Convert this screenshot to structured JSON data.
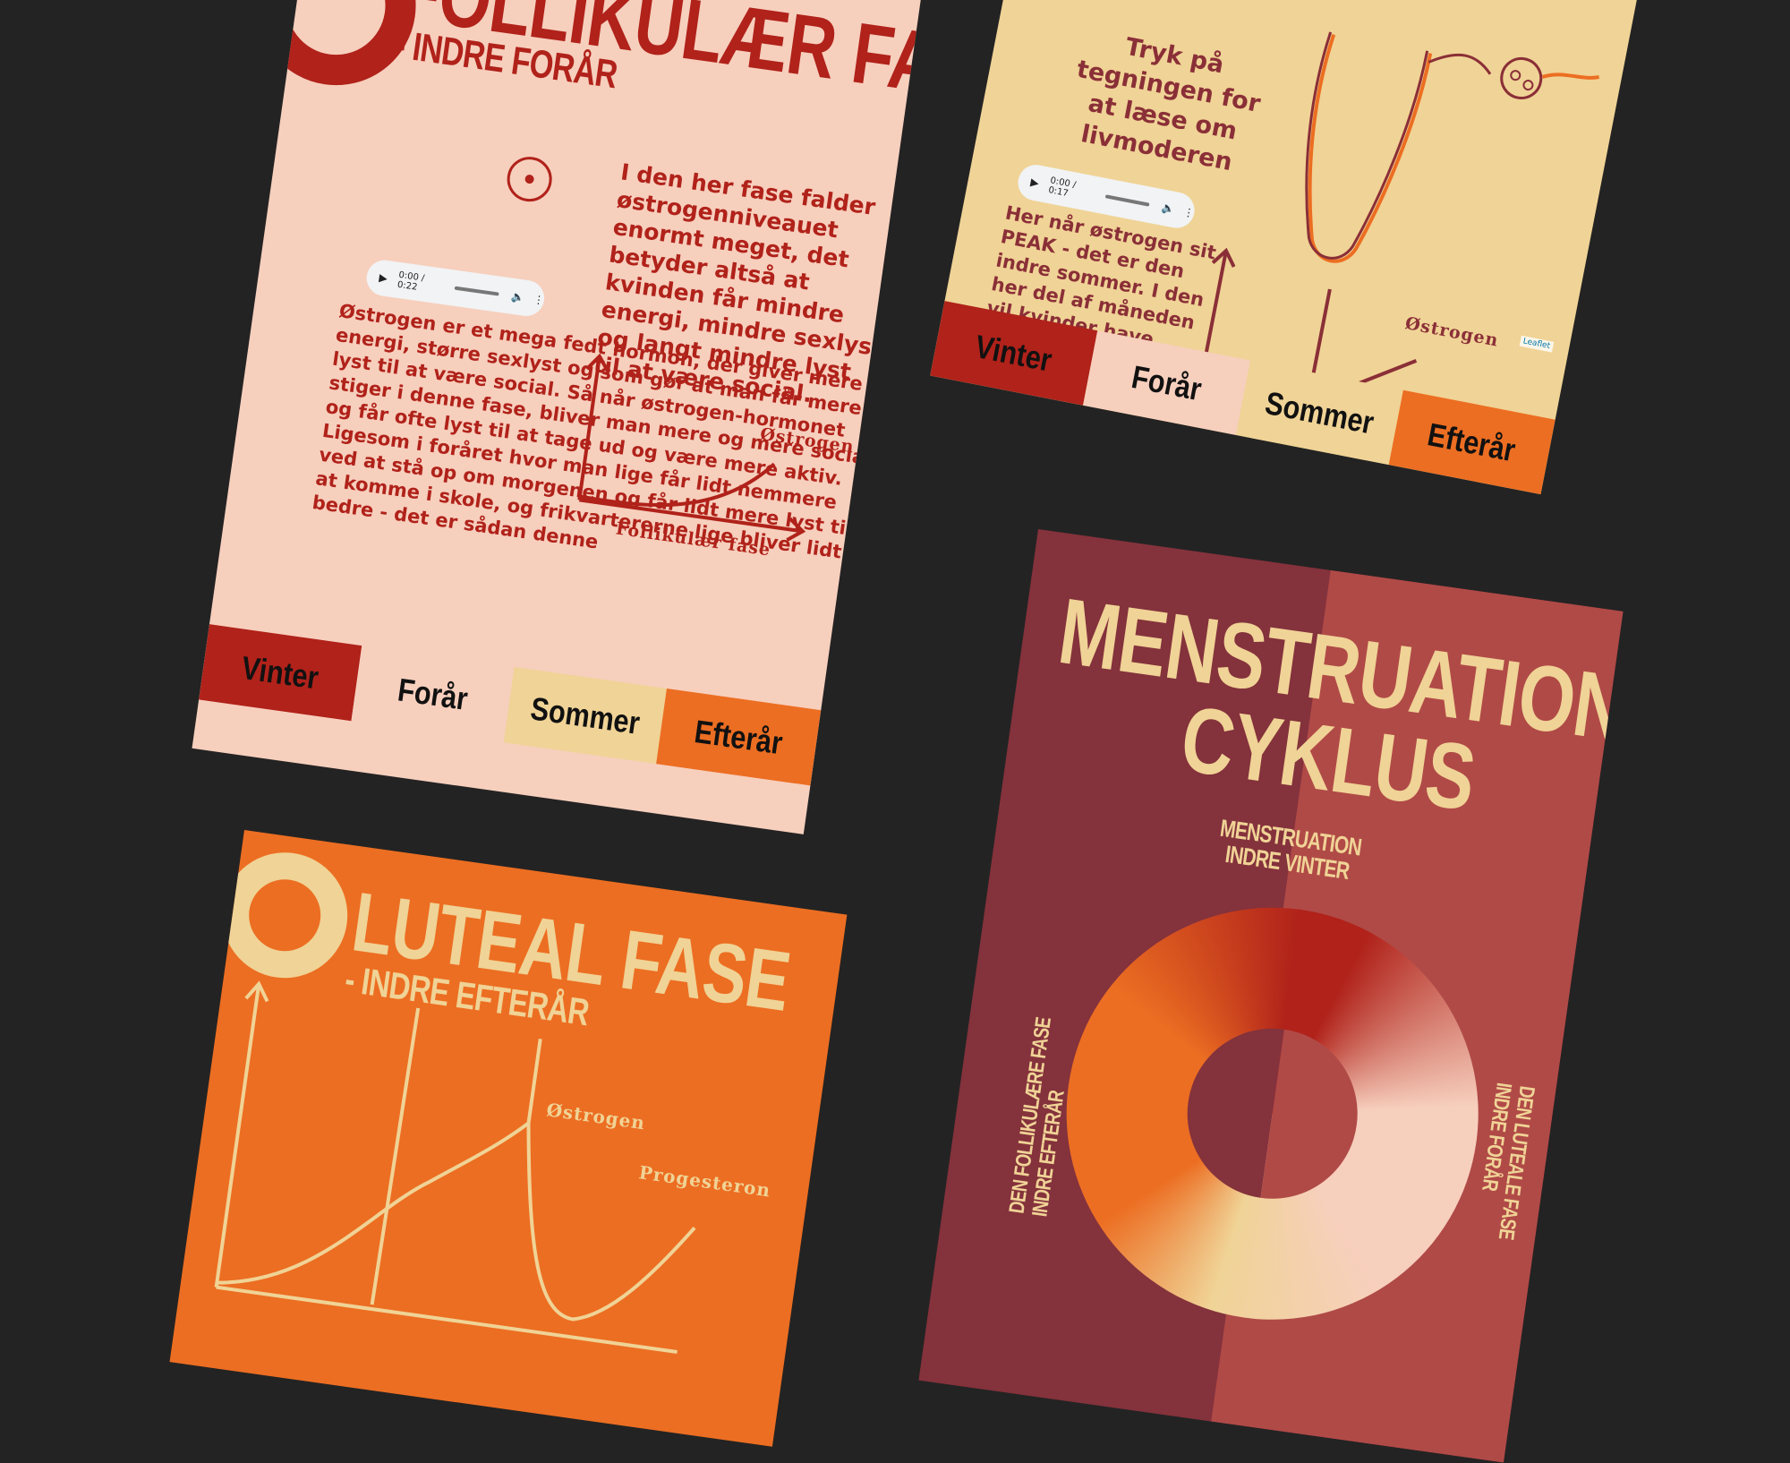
{
  "colors": {
    "background": "#232323",
    "follicular_bg": "#f7cfbd",
    "follicular_accent": "#b0221a",
    "uterus_bg": "#f0d396",
    "uterus_accent": "#8a2f37",
    "luteal_bg": "#ec6e22",
    "luteal_accent": "#f0d396",
    "cycle_bg_left": "#84323c",
    "cycle_bg_right": "#b04a47",
    "tab_vinter": "#b0221a",
    "tab_foraar": "#f7cfbd",
    "tab_sommer": "#f0d396",
    "tab_efteraar": "#ec6e22"
  },
  "follicular": {
    "title": "FOLLIKULÆR FASE",
    "subtitle": "- INDRE FORÅR",
    "intro_text": "I den her fase falder østrogenniveauet enormt meget, det betyder altså at kvinden får mindre energi, mindre sexlyst og langt mindre lyst til at være social.",
    "audio_time": "0:00 / 0:22",
    "body_text": "Østrogen er et mega fedt hormon, der giver mere energi, større sexlyst og som gør at man får mere lyst til at være social. Så når østrogen-hormonet stiger i denne fase, bliver man mere og mere social og får ofte lyst til at tage ud og være mere aktiv. Ligesom i foråret hvor man lige får lidt nemmere ved at stå op om morgenen og får lidt mere lyst til at komme i skole, og frikvartererne lige bliver lidt bedre - det er sådan denne",
    "graph_curve_label": "Østrogen",
    "graph_axis_label": "Follikulær fase",
    "target_icon": "target-icon",
    "tabs": [
      "Vinter",
      "Forår",
      "Sommer",
      "Efterår"
    ]
  },
  "uterus": {
    "prompt": "Tryk på tegningen for at læse om livmoderen",
    "audio_time": "0:00 / 0:17",
    "peak_text_before": "Her når østrogen sit",
    "peak_word": "PEAK",
    "peak_text_after": "- det er den indre sommer. I den her del af måneden vil kvinder have allermest energi,",
    "graph_curve_label": "Østrogen",
    "map_attribution": "Leaflet",
    "tabs": [
      "Vinter",
      "Forår",
      "Sommer",
      "Efterår"
    ]
  },
  "luteal": {
    "title": "LUTEAL FASE",
    "subtitle": "- INDRE EFTERÅR",
    "label_estrogen": "Østrogen",
    "label_progesterone": "Progesteron"
  },
  "cycle": {
    "title_line1": "MENSTRUATIONS-",
    "title_line2": "CYKLUS",
    "top_label_line1": "MENSTRUATION",
    "top_label_line2": "INDRE VINTER",
    "left_label_line1": "DEN FOLLIKULÆRE FASE",
    "left_label_line2": "INDRE EFTERÅR",
    "right_label_line1": "DEN LUTEALE FASE",
    "right_label_line2": "INDRE FORÅR"
  }
}
